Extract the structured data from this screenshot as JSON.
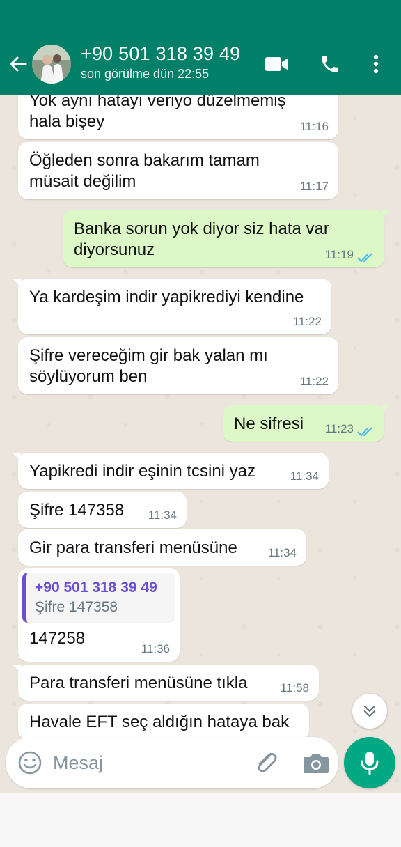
{
  "header": {
    "title": "+90 501 318 39 49",
    "subtitle": "son görülme dün 22:55",
    "color": "#008069"
  },
  "messages": [
    {
      "direction": "in",
      "text": "Yok aynı hatayı veriyo düzelmemiş hala bişey",
      "time": "11:16"
    },
    {
      "direction": "in",
      "text": "Öğleden sonra bakarım tamam müsait değilim",
      "time": "11:17"
    },
    {
      "direction": "out",
      "text": "Banka sorun yok diyor siz hata var diyorsunuz",
      "time": "11:19",
      "status": "read"
    },
    {
      "direction": "in",
      "text": "Ya kardeşim indir yapikrediyi kendine",
      "time": "11:22"
    },
    {
      "direction": "in",
      "text": "Şifre vereceğim gir bak yalan mı söylüyorum ben",
      "time": "11:22"
    },
    {
      "direction": "out",
      "text": "Ne sifresi",
      "time": "11:23",
      "status": "read"
    },
    {
      "direction": "in",
      "text": "Yapikredi indir eşinin tcsini yaz",
      "time": "11:34"
    },
    {
      "direction": "in",
      "text": "Şifre 147358",
      "time": "11:34"
    },
    {
      "direction": "in",
      "text": "Gir para transferi menüsüne",
      "time": "11:34"
    },
    {
      "direction": "in",
      "text": "147258",
      "time": "11:36",
      "quote": {
        "name": "+90 501 318 39 49",
        "text": "Şifre 147358"
      }
    },
    {
      "direction": "in",
      "text": "Para transferi menüsüne tıkla",
      "time": "11:58"
    },
    {
      "direction": "in",
      "text": "Havale EFT seç aldığın hataya bak",
      "time": ""
    }
  ],
  "input": {
    "placeholder": "Mesaj"
  },
  "icons": {
    "back": "arrow-left-icon",
    "video": "video-call-icon",
    "call": "phone-icon",
    "menu": "more-vert-icon",
    "emoji": "emoji-icon",
    "attach": "paperclip-icon",
    "camera": "camera-icon",
    "mic": "mic-icon",
    "scroll": "double-chevron-down-icon"
  },
  "colors": {
    "incoming": "#ffffff",
    "outgoing": "#dcf8c6",
    "read_check": "#53bdeb",
    "accent": "#00a884",
    "quote_name": "#6b4ed1"
  }
}
